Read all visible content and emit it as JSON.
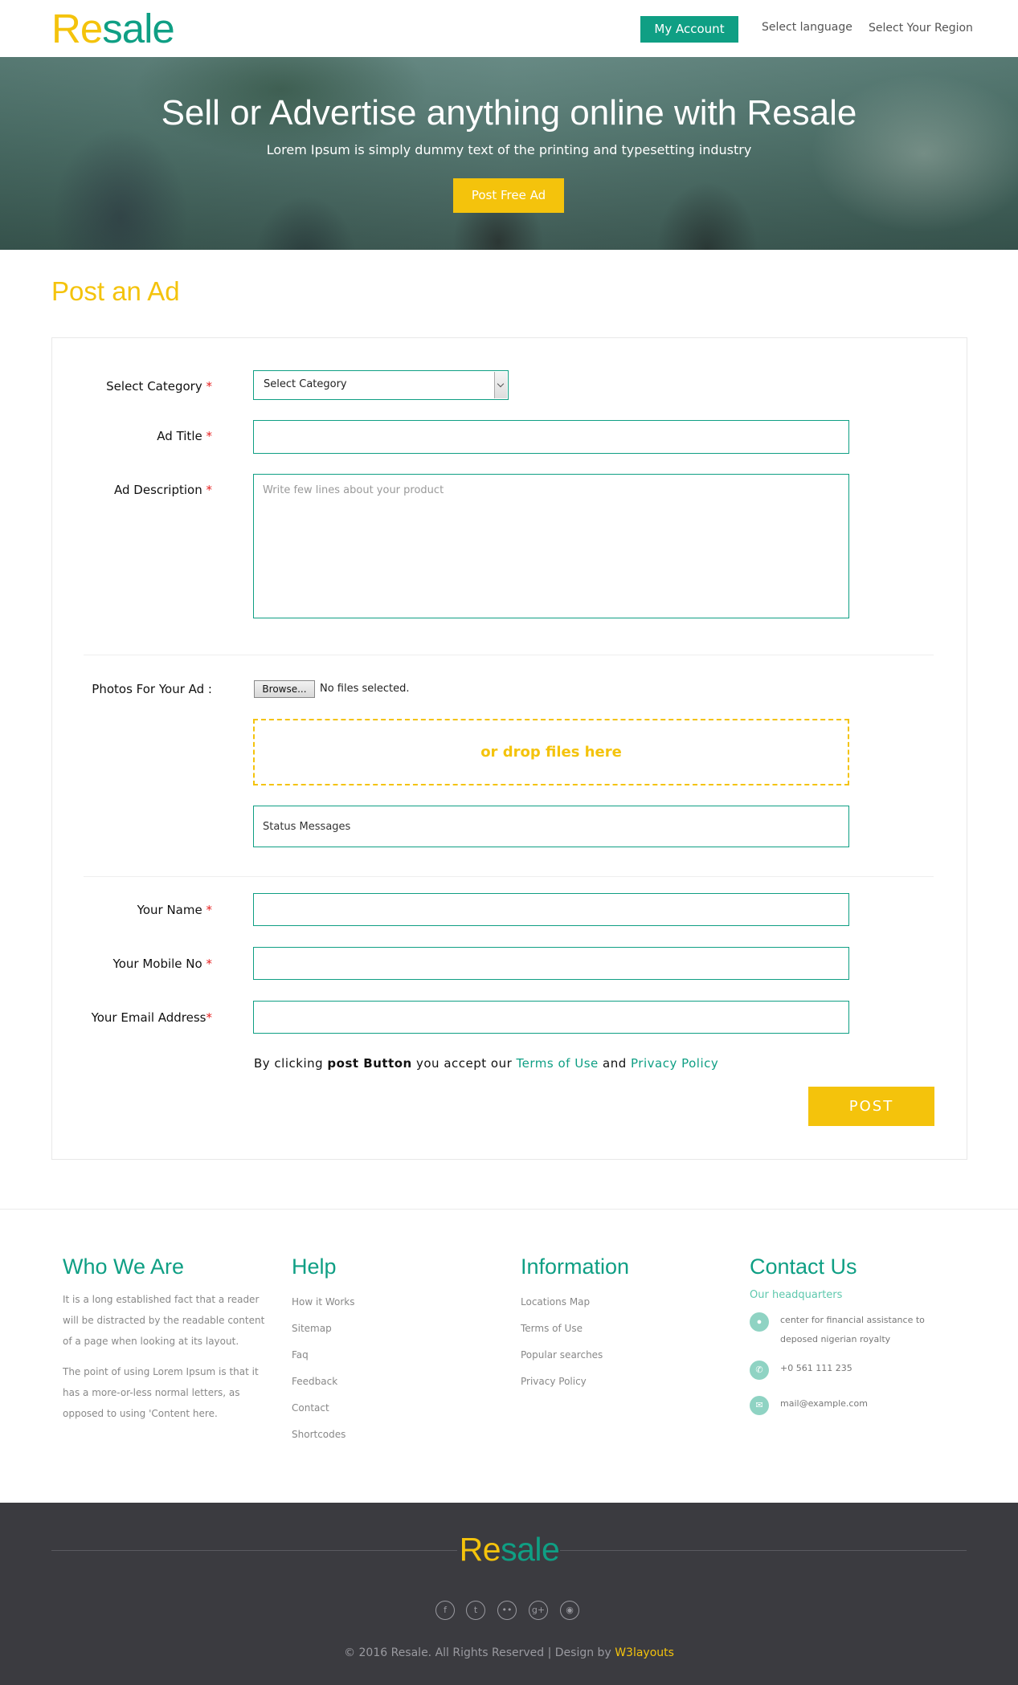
{
  "header": {
    "logo_re": "Re",
    "logo_sale": "sale",
    "my_account": "My Account",
    "select_language": "Select language",
    "select_region": "Select Your Region"
  },
  "banner": {
    "title": "Sell or Advertise anything online with Resale",
    "subtitle": "Lorem Ipsum is simply dummy text of the printing and typesetting industry",
    "button": "Post Free Ad"
  },
  "post_ad": {
    "title": "Post an Ad",
    "category_label": "Select Category",
    "category_value": "Select Category",
    "title_label": "Ad Title",
    "description_label": "Ad Description",
    "description_placeholder": "Write few lines about your product",
    "photos_label": "Photos For Your Ad :",
    "browse": "Browse...",
    "no_files": "No files selected.",
    "drop_text": "or drop files here",
    "status_messages": "Status Messages",
    "name_label": "Your Name",
    "mobile_label": "Your Mobile No",
    "email_label": "Your Email Address",
    "required_mark": "*",
    "terms_prefix": "By clicking ",
    "terms_bold": "post Button",
    "terms_middle": " you accept our ",
    "terms_link": "Terms of Use",
    "terms_and": " and ",
    "privacy_link": "Privacy Policy",
    "post_button": "POST"
  },
  "footer": {
    "who_title": "Who We Are",
    "who_p1": "It is a long established fact that a reader will be distracted by the readable content of a page when looking at its layout.",
    "who_p2": "The point of using Lorem Ipsum is that it has a more-or-less normal letters, as opposed to using 'Content here.",
    "help_title": "Help",
    "help_links": [
      "How it Works",
      "Sitemap",
      "Faq",
      "Feedback",
      "Contact",
      "Shortcodes"
    ],
    "info_title": "Information",
    "info_links": [
      "Locations Map",
      "Terms of Use",
      "Popular searches",
      "Privacy Policy"
    ],
    "contact_title": "Contact Us",
    "headquarters": "Our headquarters",
    "address": "center for financial assistance to deposed nigerian royalty",
    "phone": "+0 561 111 235",
    "email": "mail@example.com",
    "copyright": "© 2016 Resale. All Rights Reserved | Design by ",
    "designer": "W3layouts",
    "social_icons": [
      "facebook-icon",
      "twitter-icon",
      "flickr-icon",
      "googleplus-icon",
      "dribbble-icon"
    ]
  },
  "colors": {
    "brand_yellow": "#f4c30c",
    "brand_green": "#0f9f84",
    "footer_dark": "#3b3b40"
  }
}
